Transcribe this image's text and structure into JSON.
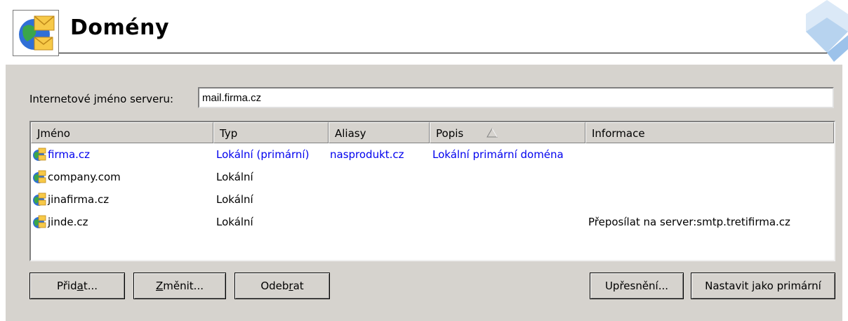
{
  "header": {
    "title": "Domény"
  },
  "server": {
    "label": "Internetové jméno serveru:",
    "value": "mail.firma.cz"
  },
  "table": {
    "columns": [
      "Jméno",
      "Typ",
      "Aliasy",
      "Popis",
      "Informace"
    ],
    "sorted_column": "Popis",
    "rows": [
      {
        "name": "firma.cz",
        "type": "Lokální (primární)",
        "aliases": "nasprodukt.cz",
        "description": "Lokální primární doména",
        "info": "",
        "primary": true
      },
      {
        "name": "company.com",
        "type": "Lokální",
        "aliases": "",
        "description": "",
        "info": ""
      },
      {
        "name": "jinafirma.cz",
        "type": "Lokální",
        "aliases": "",
        "description": "",
        "info": ""
      },
      {
        "name": "jinde.cz",
        "type": "Lokální",
        "aliases": "",
        "description": "",
        "info": "Přeposílat na server:smtp.tretifirma.cz"
      }
    ]
  },
  "buttons": {
    "add": {
      "pre": "Přid",
      "key": "a",
      "post": "t..."
    },
    "edit": {
      "pre": "",
      "key": "Z",
      "post": "měnit..."
    },
    "remove": {
      "pre": "Odeb",
      "key": "r",
      "post": "at"
    },
    "advanced": "Upřesnění...",
    "set_primary": "Nastavit jako primární"
  },
  "colors": {
    "primary_row": "#0000ee",
    "panel": "#d6d3ce"
  },
  "icons": {
    "logo": "globe-mail-icon",
    "row": "domain-mail-icon",
    "sort": "sort-ascending-icon"
  }
}
